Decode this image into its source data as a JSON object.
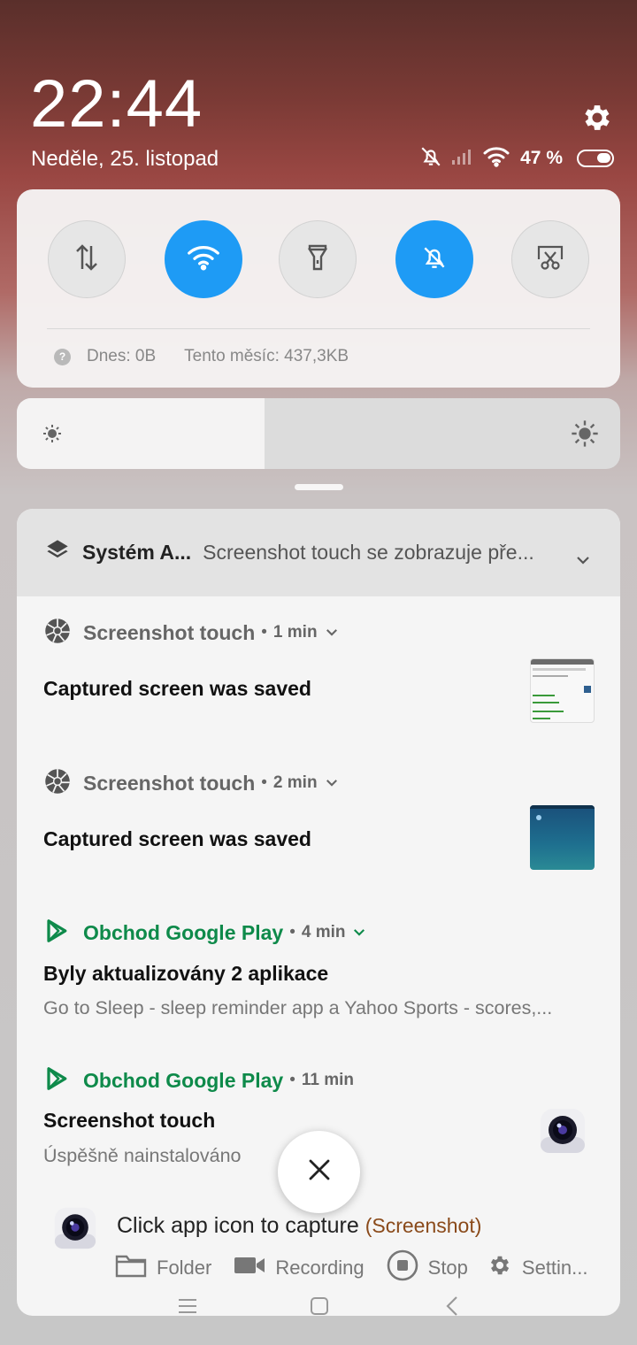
{
  "status": {
    "time": "22:44",
    "date": "Neděle, 25. listopad",
    "battery_percent": "47 %"
  },
  "quick_settings": {
    "toggles": [
      {
        "name": "mobile-data",
        "icon": "data-arrows-icon",
        "on": false
      },
      {
        "name": "wifi",
        "icon": "wifi-icon",
        "on": true
      },
      {
        "name": "flashlight",
        "icon": "flashlight-icon",
        "on": false
      },
      {
        "name": "silent",
        "icon": "bell-off-icon",
        "on": true
      },
      {
        "name": "screenshot",
        "icon": "scissors-icon",
        "on": false
      }
    ],
    "usage_today": "Dnes: 0B",
    "usage_month": "Tento měsíc: 437,3KB"
  },
  "brightness": {
    "level_percent": 41
  },
  "notifications": {
    "system": {
      "app": "Systém A...",
      "message": "Screenshot touch se zobrazuje pře..."
    },
    "items": [
      {
        "app": "Screenshot touch",
        "time": "1 min",
        "title": "Captured screen was saved",
        "text": ""
      },
      {
        "app": "Screenshot touch",
        "time": "2 min",
        "title": "Captured screen was saved",
        "text": ""
      },
      {
        "app": "Obchod Google Play",
        "time": "4 min",
        "title": "Byly aktualizovány 2 aplikace",
        "text": "Go to Sleep - sleep reminder app a Yahoo Sports - scores,..."
      },
      {
        "app": "Obchod Google Play",
        "time": "11 min",
        "title": "Screenshot touch",
        "text": "Úspěšně nainstalováno"
      }
    ]
  },
  "capture_bar": {
    "hint": "Click app icon to capture",
    "hint_tag": "(Screenshot)",
    "actions": {
      "folder": "Folder",
      "recording": "Recording",
      "stop": "Stop",
      "settings": "Settin..."
    }
  },
  "colors": {
    "accent": "#1e9bf5",
    "play_green": "#0e8a4a"
  }
}
